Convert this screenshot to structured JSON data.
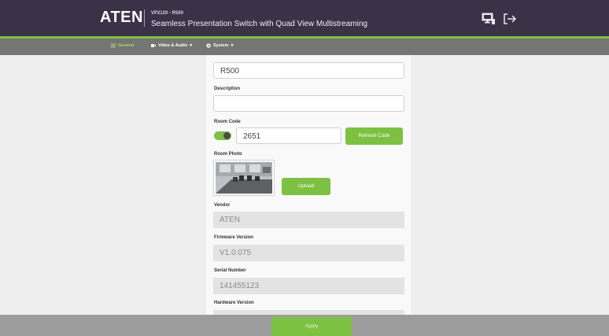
{
  "header": {
    "logo": "ATEN",
    "model": "VP2120 - R500",
    "subtitle": "Seamless Presentation Switch with Quad View Multistreaming",
    "icons": [
      "monitor-icon",
      "logout-icon"
    ]
  },
  "menu": {
    "items": [
      {
        "label": "General",
        "icon": "list-icon",
        "active": true
      },
      {
        "label": "Video & Audio",
        "icon": "video-icon",
        "active": false
      },
      {
        "label": "System",
        "icon": "gear-icon",
        "active": false
      }
    ]
  },
  "form": {
    "name_value": "R500",
    "description_label": "Description",
    "description_value": "",
    "room_code_label": "Room Code",
    "room_code_value": "2651",
    "room_code_enabled": true,
    "refresh_label": "Refresh Code",
    "room_photo_label": "Room Photo",
    "upload_label": "Upload",
    "vendor_label": "Vendor",
    "vendor_value": "ATEN",
    "firmware_label": "Firmware Version",
    "firmware_value": "V1.0.075",
    "serial_label": "Serial Number",
    "serial_value": "141455123",
    "hardware_label": "Hardware Version"
  },
  "footer": {
    "apply_label": "Apply"
  },
  "colors": {
    "header_bg": "#3b3248",
    "accent_green": "#7dc142",
    "menubar_bg": "#757575",
    "footer_bg": "#9c9c9c"
  }
}
